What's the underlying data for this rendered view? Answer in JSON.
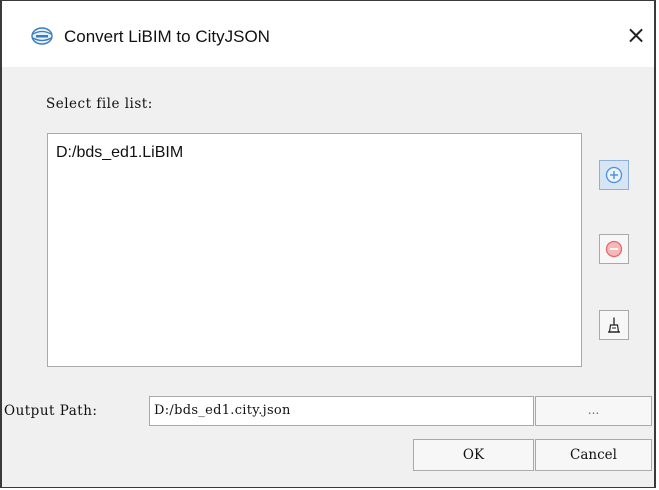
{
  "window": {
    "title": "Convert LiBIM to CityJSON",
    "close_glyph": "×",
    "app_icon": "app-logo-icon"
  },
  "file_section": {
    "label": "Select file list:",
    "files": [
      "D:/bds_ed1.LiBIM"
    ]
  },
  "side_buttons": {
    "add_icon": "plus-circle-icon",
    "remove_icon": "minus-circle-icon",
    "clear_icon": "broom-icon"
  },
  "output": {
    "label": "Output Path:",
    "value": "D:/bds_ed1.city.json",
    "browse_label": "..."
  },
  "buttons": {
    "ok": "OK",
    "cancel": "Cancel"
  },
  "colors": {
    "add_accent": "#4a90d9",
    "remove_accent": "#e46a6a"
  }
}
